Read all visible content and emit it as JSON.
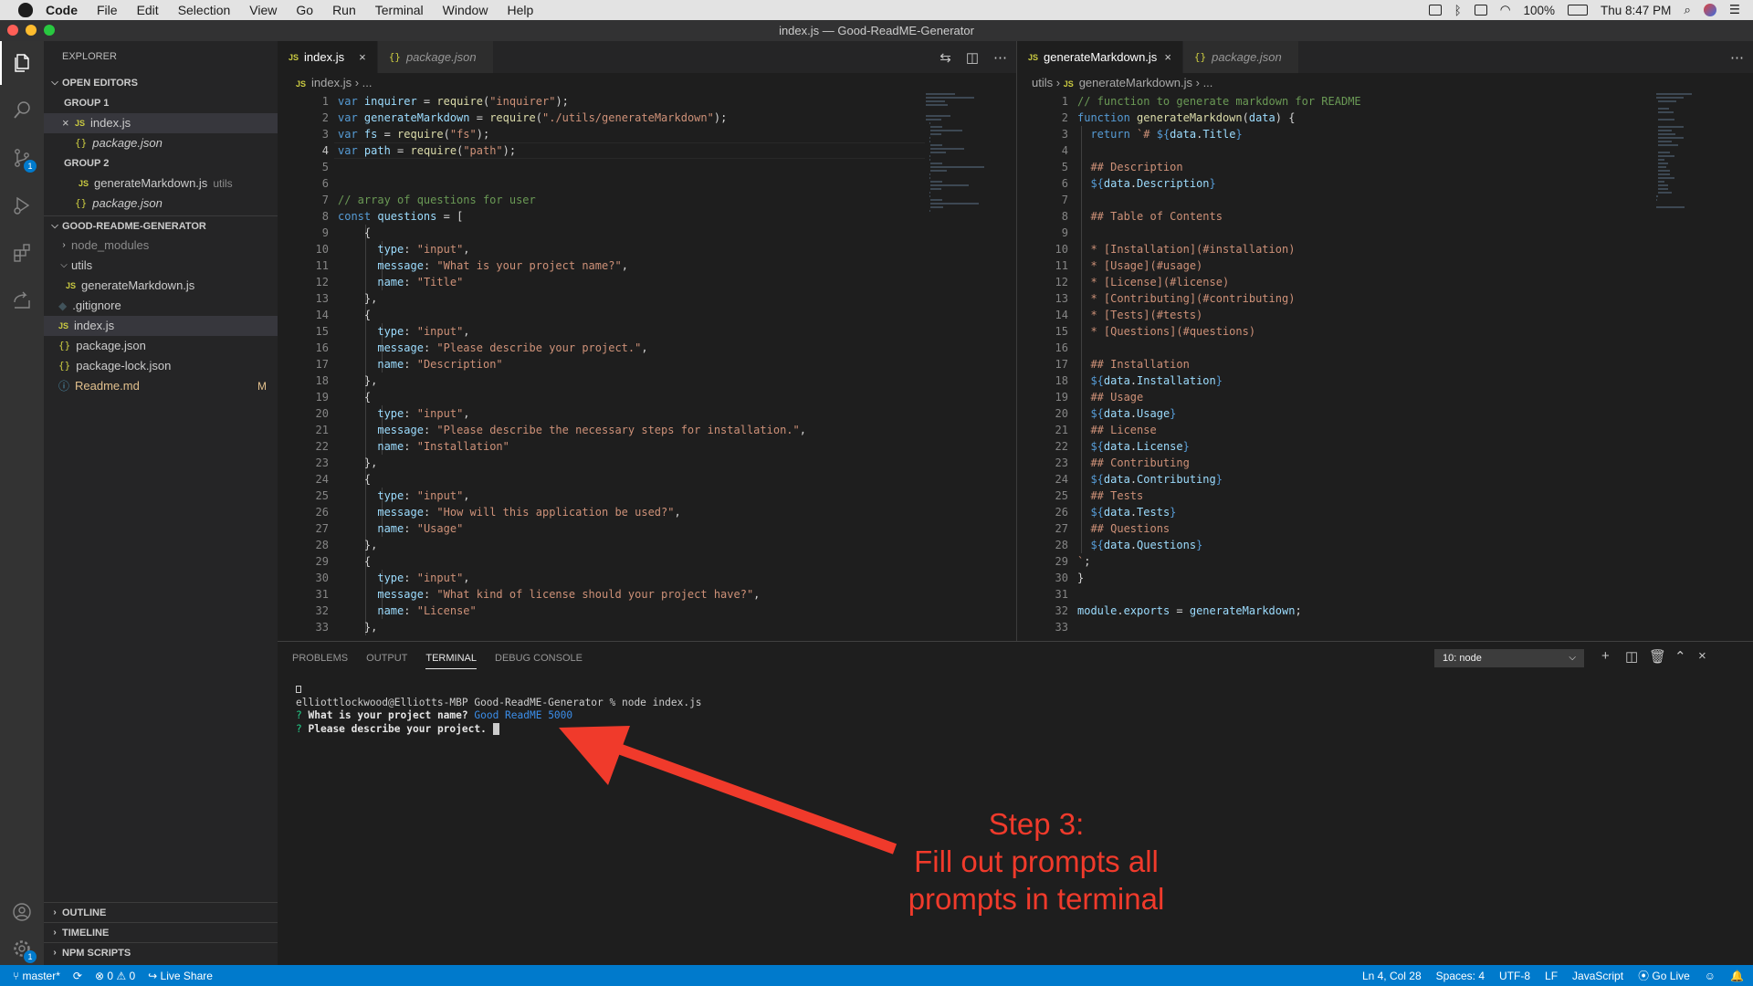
{
  "macos": {
    "app_name": "Code",
    "menus": [
      "File",
      "Edit",
      "Selection",
      "View",
      "Go",
      "Run",
      "Terminal",
      "Window",
      "Help"
    ],
    "battery": "100%",
    "clock": "Thu 8:47 PM"
  },
  "window": {
    "title": "index.js — Good-ReadME-Generator"
  },
  "activity_bar": {
    "icons": [
      "explorer-icon",
      "search-icon",
      "source-control-icon",
      "run-debug-icon",
      "extensions-icon",
      "live-share-icon",
      "account-icon",
      "settings-gear-icon"
    ],
    "scm_badge": "1",
    "settings_badge": "1"
  },
  "explorer": {
    "title": "EXPLORER",
    "open_editors": {
      "label": "OPEN EDITORS",
      "group1": "GROUP 1",
      "group1_files": [
        "index.js",
        "package.json"
      ],
      "group2": "GROUP 2",
      "group2_files": [
        "generateMarkdown.js",
        "package.json"
      ],
      "group2_hint": "utils"
    },
    "project": {
      "label": "GOOD-README-GENERATOR",
      "items": [
        "node_modules",
        "utils",
        "generateMarkdown.js",
        ".gitignore",
        "index.js",
        "package.json",
        "package-lock.json",
        "Readme.md"
      ],
      "readme_flag": "M"
    },
    "outline": "OUTLINE",
    "timeline": "TIMELINE",
    "npm_scripts": "NPM SCRIPTS"
  },
  "editor_left": {
    "tabs": [
      {
        "label": "index.js",
        "close": "×"
      },
      {
        "label": "package.json"
      }
    ],
    "breadcrumb_file": "index.js",
    "breadcrumb_tail": "...",
    "line_numbers": [
      "1",
      "2",
      "3",
      "4",
      "5",
      "6",
      "7",
      "8",
      "9",
      "10",
      "11",
      "12",
      "13",
      "14",
      "15",
      "16",
      "17",
      "18",
      "19",
      "20",
      "21",
      "22",
      "23",
      "24",
      "25",
      "26",
      "27",
      "28",
      "29",
      "30",
      "31",
      "32",
      "33"
    ]
  },
  "editor_right": {
    "tabs": [
      {
        "label": "generateMarkdown.js",
        "close": "×"
      },
      {
        "label": "package.json"
      }
    ],
    "breadcrumb_folder": "utils",
    "breadcrumb_file": "generateMarkdown.js",
    "breadcrumb_tail": "...",
    "line_numbers": [
      "1",
      "2",
      "3",
      "4",
      "5",
      "6",
      "7",
      "8",
      "9",
      "10",
      "11",
      "12",
      "13",
      "14",
      "15",
      "16",
      "17",
      "18",
      "19",
      "20",
      "21",
      "22",
      "23",
      "24",
      "25",
      "26",
      "27",
      "28",
      "29",
      "30",
      "31",
      "32",
      "33"
    ]
  },
  "code_left": [
    [
      [
        "kw",
        "var "
      ],
      [
        "vr",
        "inquirer"
      ],
      [
        "pu",
        " = "
      ],
      [
        "fn",
        "require"
      ],
      [
        "pu",
        "("
      ],
      [
        "st",
        "\"inquirer\""
      ],
      [
        "pu",
        ");"
      ]
    ],
    [
      [
        "kw",
        "var "
      ],
      [
        "vr",
        "generateMarkdown"
      ],
      [
        "pu",
        " = "
      ],
      [
        "fn",
        "require"
      ],
      [
        "pu",
        "("
      ],
      [
        "st",
        "\"./utils/generateMarkdown\""
      ],
      [
        "pu",
        ");"
      ]
    ],
    [
      [
        "kw",
        "var "
      ],
      [
        "vr",
        "fs"
      ],
      [
        "pu",
        " = "
      ],
      [
        "fn",
        "require"
      ],
      [
        "pu",
        "("
      ],
      [
        "st",
        "\"fs\""
      ],
      [
        "pu",
        ");"
      ]
    ],
    [
      [
        "kw",
        "var "
      ],
      [
        "vr",
        "path"
      ],
      [
        "pu",
        " = "
      ],
      [
        "fn",
        "require"
      ],
      [
        "pu",
        "("
      ],
      [
        "st",
        "\"path\""
      ],
      [
        "pu",
        ");"
      ]
    ],
    [],
    [],
    [
      [
        "cm",
        "// array of questions for user"
      ]
    ],
    [
      [
        "kw",
        "const "
      ],
      [
        "vr",
        "questions"
      ],
      [
        "pu",
        " = ["
      ]
    ],
    [
      [
        "pu",
        "    {"
      ]
    ],
    [
      [
        "pu",
        "      "
      ],
      [
        "vr",
        "type"
      ],
      [
        "pu",
        ": "
      ],
      [
        "st",
        "\"input\""
      ],
      [
        "pu",
        ","
      ]
    ],
    [
      [
        "pu",
        "      "
      ],
      [
        "vr",
        "message"
      ],
      [
        "pu",
        ": "
      ],
      [
        "st",
        "\"What is your project name?\""
      ],
      [
        "pu",
        ","
      ]
    ],
    [
      [
        "pu",
        "      "
      ],
      [
        "vr",
        "name"
      ],
      [
        "pu",
        ": "
      ],
      [
        "st",
        "\"Title\""
      ]
    ],
    [
      [
        "pu",
        "    },"
      ]
    ],
    [
      [
        "pu",
        "    {"
      ]
    ],
    [
      [
        "pu",
        "      "
      ],
      [
        "vr",
        "type"
      ],
      [
        "pu",
        ": "
      ],
      [
        "st",
        "\"input\""
      ],
      [
        "pu",
        ","
      ]
    ],
    [
      [
        "pu",
        "      "
      ],
      [
        "vr",
        "message"
      ],
      [
        "pu",
        ": "
      ],
      [
        "st",
        "\"Please describe your project.\""
      ],
      [
        "pu",
        ","
      ]
    ],
    [
      [
        "pu",
        "      "
      ],
      [
        "vr",
        "name"
      ],
      [
        "pu",
        ": "
      ],
      [
        "st",
        "\"Description\""
      ]
    ],
    [
      [
        "pu",
        "    },"
      ]
    ],
    [
      [
        "pu",
        "    {"
      ]
    ],
    [
      [
        "pu",
        "      "
      ],
      [
        "vr",
        "type"
      ],
      [
        "pu",
        ": "
      ],
      [
        "st",
        "\"input\""
      ],
      [
        "pu",
        ","
      ]
    ],
    [
      [
        "pu",
        "      "
      ],
      [
        "vr",
        "message"
      ],
      [
        "pu",
        ": "
      ],
      [
        "st",
        "\"Please describe the necessary steps for installation.\""
      ],
      [
        "pu",
        ","
      ]
    ],
    [
      [
        "pu",
        "      "
      ],
      [
        "vr",
        "name"
      ],
      [
        "pu",
        ": "
      ],
      [
        "st",
        "\"Installation\""
      ]
    ],
    [
      [
        "pu",
        "    },"
      ]
    ],
    [
      [
        "pu",
        "    {"
      ]
    ],
    [
      [
        "pu",
        "      "
      ],
      [
        "vr",
        "type"
      ],
      [
        "pu",
        ": "
      ],
      [
        "st",
        "\"input\""
      ],
      [
        "pu",
        ","
      ]
    ],
    [
      [
        "pu",
        "      "
      ],
      [
        "vr",
        "message"
      ],
      [
        "pu",
        ": "
      ],
      [
        "st",
        "\"How will this application be used?\""
      ],
      [
        "pu",
        ","
      ]
    ],
    [
      [
        "pu",
        "      "
      ],
      [
        "vr",
        "name"
      ],
      [
        "pu",
        ": "
      ],
      [
        "st",
        "\"Usage\""
      ]
    ],
    [
      [
        "pu",
        "    },"
      ]
    ],
    [
      [
        "pu",
        "    {"
      ]
    ],
    [
      [
        "pu",
        "      "
      ],
      [
        "vr",
        "type"
      ],
      [
        "pu",
        ": "
      ],
      [
        "st",
        "\"input\""
      ],
      [
        "pu",
        ","
      ]
    ],
    [
      [
        "pu",
        "      "
      ],
      [
        "vr",
        "message"
      ],
      [
        "pu",
        ": "
      ],
      [
        "st",
        "\"What kind of license should your project have?\""
      ],
      [
        "pu",
        ","
      ]
    ],
    [
      [
        "pu",
        "      "
      ],
      [
        "vr",
        "name"
      ],
      [
        "pu",
        ": "
      ],
      [
        "st",
        "\"License\""
      ]
    ],
    [
      [
        "pu",
        "    },"
      ]
    ]
  ],
  "code_right": [
    [
      [
        "cm",
        "// function to generate markdown for README"
      ]
    ],
    [
      [
        "kw",
        "function "
      ],
      [
        "fn",
        "generateMarkdown"
      ],
      [
        "pu",
        "("
      ],
      [
        "vr",
        "data"
      ],
      [
        "pu",
        ") {"
      ]
    ],
    [
      [
        "pu",
        "  "
      ],
      [
        "kw",
        "return "
      ],
      [
        "st",
        "`# "
      ],
      [
        "bu",
        "${"
      ],
      [
        "vr",
        "data"
      ],
      [
        "pu",
        "."
      ],
      [
        "vr",
        "Title"
      ],
      [
        "bu",
        "}"
      ]
    ],
    [],
    [
      [
        "st",
        "  ## Description"
      ]
    ],
    [
      [
        "bu",
        "  ${"
      ],
      [
        "vr",
        "data"
      ],
      [
        "pu",
        "."
      ],
      [
        "vr",
        "Description"
      ],
      [
        "bu",
        "}"
      ]
    ],
    [],
    [
      [
        "st",
        "  ## Table of Contents"
      ]
    ],
    [],
    [
      [
        "st",
        "  * [Installation](#installation)"
      ]
    ],
    [
      [
        "st",
        "  * [Usage](#usage)"
      ]
    ],
    [
      [
        "st",
        "  * [License](#license)"
      ]
    ],
    [
      [
        "st",
        "  * [Contributing](#contributing)"
      ]
    ],
    [
      [
        "st",
        "  * [Tests](#tests)"
      ]
    ],
    [
      [
        "st",
        "  * [Questions](#questions)"
      ]
    ],
    [],
    [
      [
        "st",
        "  ## Installation"
      ]
    ],
    [
      [
        "bu",
        "  ${"
      ],
      [
        "vr",
        "data"
      ],
      [
        "pu",
        "."
      ],
      [
        "vr",
        "Installation"
      ],
      [
        "bu",
        "}"
      ]
    ],
    [
      [
        "st",
        "  ## Usage"
      ]
    ],
    [
      [
        "bu",
        "  ${"
      ],
      [
        "vr",
        "data"
      ],
      [
        "pu",
        "."
      ],
      [
        "vr",
        "Usage"
      ],
      [
        "bu",
        "}"
      ]
    ],
    [
      [
        "st",
        "  ## License"
      ]
    ],
    [
      [
        "bu",
        "  ${"
      ],
      [
        "vr",
        "data"
      ],
      [
        "pu",
        "."
      ],
      [
        "vr",
        "License"
      ],
      [
        "bu",
        "}"
      ]
    ],
    [
      [
        "st",
        "  ## Contributing"
      ]
    ],
    [
      [
        "bu",
        "  ${"
      ],
      [
        "vr",
        "data"
      ],
      [
        "pu",
        "."
      ],
      [
        "vr",
        "Contributing"
      ],
      [
        "bu",
        "}"
      ]
    ],
    [
      [
        "st",
        "  ## Tests"
      ]
    ],
    [
      [
        "bu",
        "  ${"
      ],
      [
        "vr",
        "data"
      ],
      [
        "pu",
        "."
      ],
      [
        "vr",
        "Tests"
      ],
      [
        "bu",
        "}"
      ]
    ],
    [
      [
        "st",
        "  ## Questions"
      ]
    ],
    [
      [
        "bu",
        "  ${"
      ],
      [
        "vr",
        "data"
      ],
      [
        "pu",
        "."
      ],
      [
        "vr",
        "Questions"
      ],
      [
        "bu",
        "}"
      ]
    ],
    [
      [
        "st",
        "`"
      ],
      [
        "pu",
        ";"
      ]
    ],
    [
      [
        "pu",
        "}"
      ]
    ],
    [],
    [
      [
        "vr",
        "module"
      ],
      [
        "pu",
        "."
      ],
      [
        "vr",
        "exports"
      ],
      [
        "pu",
        " = "
      ],
      [
        "vr",
        "generateMarkdown"
      ],
      [
        "pu",
        ";"
      ]
    ],
    []
  ],
  "panel": {
    "tabs": [
      "PROBLEMS",
      "OUTPUT",
      "TERMINAL",
      "DEBUG CONSOLE"
    ],
    "active_tab": "TERMINAL",
    "terminal_select": "10: node",
    "actions": [
      "plus-icon",
      "split-icon",
      "trash-icon",
      "chevron-up-icon",
      "close-icon"
    ]
  },
  "terminal": {
    "prompt_line": "elliottlockwood@Elliotts-MBP Good-ReadME-Generator % node index.js",
    "q1_mark": "?",
    "q1_text": "What is your project name?",
    "q1_answer": "Good ReadME 5000",
    "q2_mark": "?",
    "q2_text": "Please describe your project."
  },
  "annotation": {
    "line1": "Step 3:",
    "line2": "Fill out prompts all",
    "line3": "prompts in terminal",
    "color": "#f03a2b"
  },
  "status_bar": {
    "branch": "master*",
    "errors": "0",
    "warnings": "0",
    "live_share": "Live Share",
    "cursor": "Ln 4, Col 28",
    "spaces": "Spaces: 4",
    "encoding": "UTF-8",
    "eol": "LF",
    "language": "JavaScript",
    "go_live": "Go Live",
    "color": "#007acc"
  }
}
